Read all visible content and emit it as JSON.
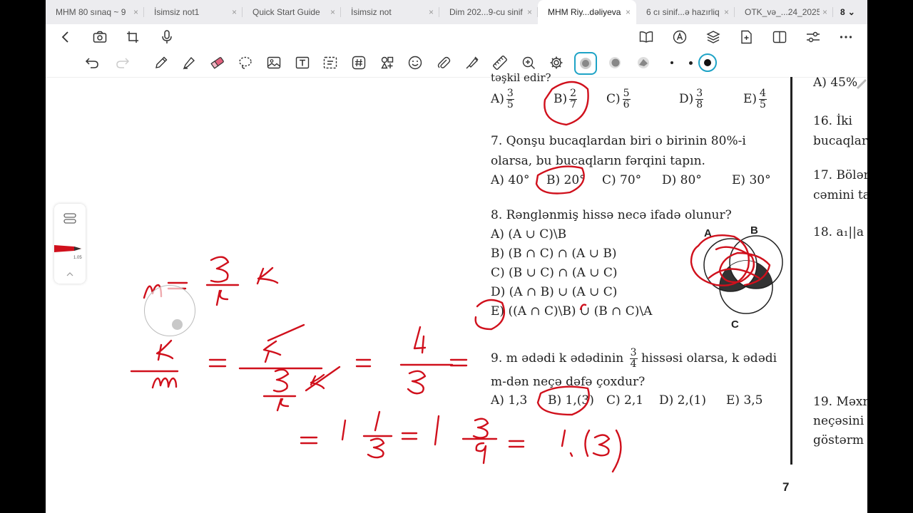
{
  "tabs": [
    {
      "label": "MHM 80 sınaq ~ 9"
    },
    {
      "label": "İsimsiz not1"
    },
    {
      "label": "Quick Start Guide"
    },
    {
      "label": "İsimsiz not"
    },
    {
      "label": "Dim 202...9-cu sinif"
    },
    {
      "label": "MHM Riy...dəliyeva",
      "active": true
    },
    {
      "label": "6 cı sinif...ə hazırliq"
    },
    {
      "label": "OTK_və_...24_2025"
    }
  ],
  "tab_count": "8",
  "tab_close_glyph": "×",
  "tab_menu_glyph": "⌄",
  "side_panel": {
    "pen_size": "1.05"
  },
  "document": {
    "q6": {
      "cont": "təşkil edir?",
      "options": [
        {
          "letter": "A)",
          "num": "3",
          "den": "5"
        },
        {
          "letter": "B)",
          "num": "2",
          "den": "7"
        },
        {
          "letter": "C)",
          "num": "5",
          "den": "6"
        },
        {
          "letter": "D)",
          "num": "3",
          "den": "8"
        },
        {
          "letter": "E)",
          "num": "4",
          "den": "5"
        }
      ]
    },
    "q7": {
      "line1": "7. Qonşu bucaqlardan biri o birinin 80%-i",
      "line2": "olarsa, bu bucaqların fərqini tapın.",
      "options": [
        "A) 40°",
        "B) 20°",
        "C) 70°",
        "D) 80°",
        "E) 30°"
      ]
    },
    "q8": {
      "text": "8. Rənglənmiş hissə necə ifadə olunur?",
      "options": [
        "A)  (A ∪ C)\\B",
        "B)  (B ∩ C) ∩ (A ∪ B)",
        "C)  (B ∪ C) ∩ (A ∪ C)",
        "D)  (A ∩ B) ∪ (A ∪ C)",
        "E)  ((A ∩ C)\\B) ∪ (B ∩ C)\\A"
      ],
      "venn_labels": [
        "A",
        "B",
        "C"
      ]
    },
    "q9": {
      "line1_a": "9. m ədədi k ədədinin",
      "line1_frac": {
        "num": "3",
        "den": "4"
      },
      "line1_b": "hissəsi olarsa, k ədədi",
      "line2": "m-dən neçə dəfə çoxdur?",
      "options": [
        "A) 1,3",
        "B) 1,(3)",
        "C) 2,1",
        "D) 2,(1)",
        "E) 3,5"
      ]
    },
    "right_column": {
      "a45": "A) 45%",
      "q16_l1": "16. İki",
      "q16_l2": "bucaqlar",
      "q17_l1": "17. Bölər",
      "q17_l2": "cəmini ta",
      "q18": "18. a₁||a",
      "q19_l1": "19. Məxr",
      "q19_l2": "neçəsini",
      "q19_l3": "göstərm"
    },
    "page_number": "7"
  },
  "colors": {
    "ink": "#d0101c",
    "accent": "#1ea3c6",
    "tab_strip": "#ececef"
  }
}
